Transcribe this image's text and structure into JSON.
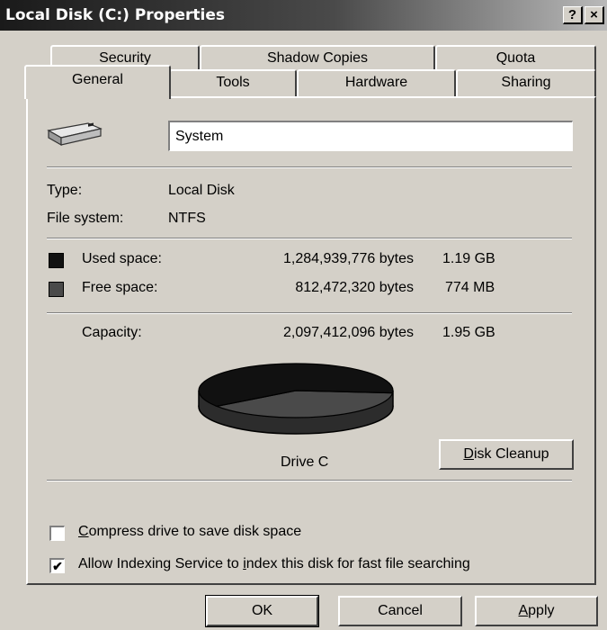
{
  "window": {
    "title": "Local Disk (C:) Properties",
    "help_label": "?",
    "close_label": "×"
  },
  "tabs": {
    "row1": [
      "Security",
      "Shadow Copies",
      "Quota"
    ],
    "row2": [
      "General",
      "Tools",
      "Hardware",
      "Sharing"
    ],
    "active": "General"
  },
  "general": {
    "volume_label_value": "System",
    "type_label": "Type:",
    "type_value": "Local Disk",
    "fs_label": "File system:",
    "fs_value": "NTFS",
    "used": {
      "label": "Used space:",
      "bytes": "1,284,939,776 bytes",
      "size": "1.19 GB",
      "color": "#111111"
    },
    "free": {
      "label": "Free space:",
      "bytes": "812,472,320 bytes",
      "size": "774 MB",
      "color": "#4a4a4a"
    },
    "capacity": {
      "label": "Capacity:",
      "bytes": "2,097,412,096 bytes",
      "size": "1.95 GB"
    },
    "used_fraction": 0.6126,
    "drive_label": "Drive C",
    "disk_cleanup": {
      "accel": "D",
      "rest": "isk Cleanup"
    },
    "compress": {
      "accel": "C",
      "rest": "ompress drive to save disk space",
      "checked": false
    },
    "indexing": {
      "before": "Allow Indexing Service to ",
      "accel": "i",
      "after": "ndex this disk for fast file searching",
      "checked": true
    }
  },
  "buttons": {
    "ok": "OK",
    "cancel": "Cancel",
    "apply": {
      "accel": "A",
      "rest": "pply"
    }
  }
}
